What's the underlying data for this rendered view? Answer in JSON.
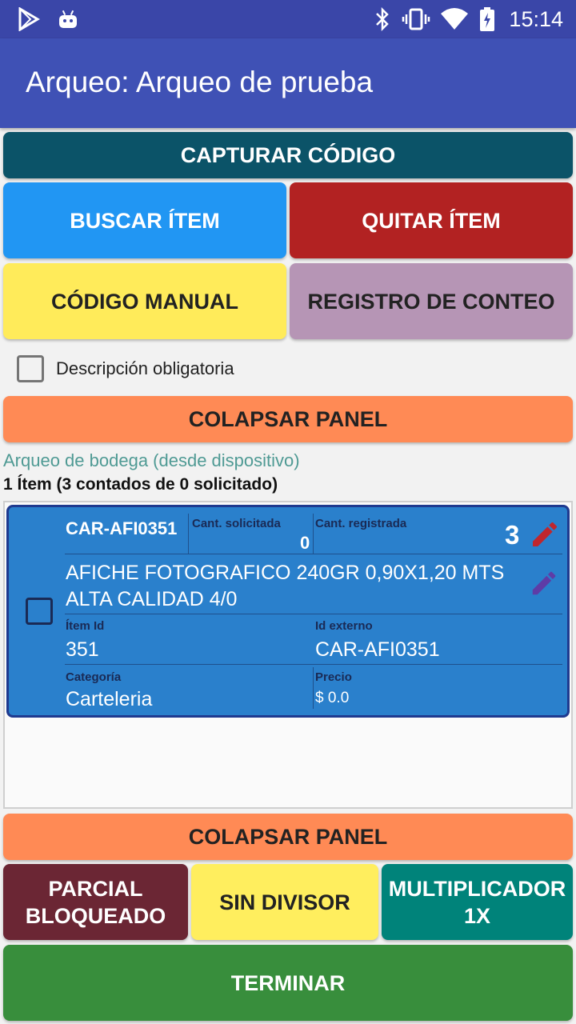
{
  "status_bar": {
    "time": "15:14",
    "icons": [
      "play-store-icon",
      "android-icon",
      "bluetooth-icon",
      "vibrate-icon",
      "wifi-icon",
      "battery-charging-icon"
    ]
  },
  "app_bar": {
    "title": "Arqueo: Arqueo de prueba"
  },
  "buttons": {
    "capturar": "CAPTURAR CÓDIGO",
    "buscar": "BUSCAR ÍTEM",
    "quitar": "QUITAR ÍTEM",
    "codigo_manual": "CÓDIGO MANUAL",
    "registro": "REGISTRO DE CONTEO",
    "colapsar_top": "COLAPSAR PANEL",
    "colapsar_bottom": "COLAPSAR PANEL",
    "parcial": "PARCIAL BLOQUEADO",
    "sin_divisor": "SIN DIVISOR",
    "multiplicador": "MULTIPLICADOR 1X",
    "terminar": "TERMINAR"
  },
  "checkbox": {
    "label": "Descripción obligatoria",
    "checked": false
  },
  "summary": {
    "source": "Arqueo de bodega (desde dispositivo)",
    "count": "1 Ítem (3 contados de 0 solicitado)"
  },
  "item": {
    "code": "CAR-AFI0351",
    "cant_solicitada_label": "Cant. solicitada",
    "cant_solicitada": "0",
    "cant_registrada_label": "Cant. registrada",
    "cant_registrada": "3",
    "description": "AFICHE   FOTOGRAFICO  240GR 0,90X1,20 MTS  ALTA CALIDAD 4/0",
    "item_id_label": "Ítem Id",
    "item_id": "351",
    "id_externo_label": "Id externo",
    "id_externo": "CAR-AFI0351",
    "categoria_label": "Categoría",
    "categoria": "Carteleria",
    "precio_label": "Precio",
    "precio": "$ 0.0",
    "checked": false
  },
  "colors": {
    "capturar": "#0b5368",
    "buscar": "#2196f3",
    "quitar": "#b22222",
    "codigo_manual": "#ffeb5a",
    "registro": "#b695b5",
    "colapsar": "#ff8a55",
    "parcial": "#6b2634",
    "sin_divisor": "#ffee5e",
    "multiplicador": "#00837a",
    "terminar": "#388e3c",
    "pencil_red": "#c0262d",
    "pencil_purple": "#5e3ca6"
  }
}
